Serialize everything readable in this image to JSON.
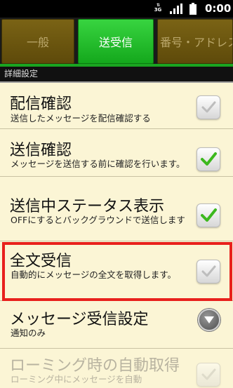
{
  "status_bar": {
    "network": "3G",
    "time": "0:00",
    "icons": [
      "3g-data-icon",
      "signal-icon",
      "battery-icon"
    ]
  },
  "tabs": [
    {
      "label": "一般",
      "state": "inactive"
    },
    {
      "label": "送受信",
      "state": "active"
    },
    {
      "label": "番号・アドレス",
      "state": "inactive"
    }
  ],
  "section_header": "詳細設定",
  "settings": [
    {
      "title": "配信確認",
      "summary": "送信したメッセージを配信確認する",
      "control": "checkbox",
      "checked": false,
      "enabled": true
    },
    {
      "title": "送信確認",
      "summary": "メッセージを送信する前に確認を行います。",
      "control": "checkbox",
      "checked": true,
      "enabled": true
    },
    {
      "title": "送信中ステータス表示",
      "summary": "OFFにするとバックグラウンドで送信します",
      "control": "checkbox",
      "checked": true,
      "enabled": true
    },
    {
      "title": "全文受信",
      "summary": "自動的にメッセージの全文を取得します。",
      "control": "checkbox",
      "checked": false,
      "enabled": true,
      "highlighted": true
    },
    {
      "title": "メッセージ受信設定",
      "summary": "通知のみ",
      "control": "dropdown",
      "enabled": true
    },
    {
      "title": "ローミング時の自動取得",
      "summary": "ローミング中にメッセージを自動",
      "control": "checkbox",
      "checked": false,
      "enabled": false
    }
  ],
  "colors": {
    "active_tab": "#1aa520",
    "inactive_tab": "#6e570f",
    "list_background": "#fbf5d5",
    "highlight_border": "#e8201c",
    "checkmark": "#3cb81e"
  }
}
